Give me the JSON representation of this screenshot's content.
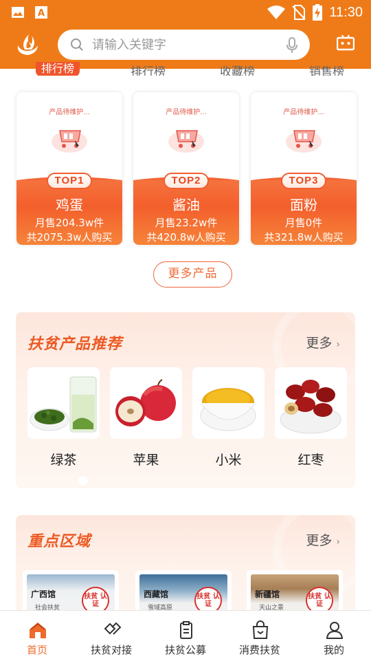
{
  "statusbar": {
    "time": "11:30"
  },
  "search": {
    "placeholder": "请输入关键字"
  },
  "tabs": [
    {
      "label": "排行榜",
      "active": true
    },
    {
      "label": "排行榜",
      "active": false
    },
    {
      "label": "收藏榜",
      "active": false
    },
    {
      "label": "销售榜",
      "active": false
    }
  ],
  "top_products": [
    {
      "placeholder": "产品待维护...",
      "rank": "TOP1",
      "name": "鸡蛋",
      "monthly": "月售204.3w件",
      "total": "共2075.3w人购买"
    },
    {
      "placeholder": "产品待维护...",
      "rank": "TOP2",
      "name": "酱油",
      "monthly": "月售23.2w件",
      "total": "共420.8w人购买"
    },
    {
      "placeholder": "产品待维护...",
      "rank": "TOP3",
      "name": "面粉",
      "monthly": "月售0件",
      "total": "共321.8w人购买"
    }
  ],
  "more_products_label": "更多产品",
  "poverty_section": {
    "title": "扶贫产品推荐",
    "more": "更多",
    "items": [
      {
        "name": "绿茶"
      },
      {
        "name": "苹果"
      },
      {
        "name": "小米"
      },
      {
        "name": "红枣"
      }
    ]
  },
  "region_section": {
    "title": "重点区域",
    "more": "更多",
    "items": [
      {
        "label": "广西馆",
        "sub": "社会扶贫",
        "stamp": "扶贫 认证"
      },
      {
        "label": "西藏馆",
        "sub": "雪域高原",
        "stamp": "扶贫 认证"
      },
      {
        "label": "新疆馆",
        "sub": "天山之景",
        "stamp": "扶贫 认证"
      }
    ]
  },
  "navbar": [
    {
      "label": "首页",
      "icon": "home-icon",
      "active": true
    },
    {
      "label": "扶贫对接",
      "icon": "handshake-icon",
      "active": false
    },
    {
      "label": "扶贫公募",
      "icon": "clipboard-icon",
      "active": false
    },
    {
      "label": "消费扶贫",
      "icon": "shopping-bag-icon",
      "active": false
    },
    {
      "label": "我的",
      "icon": "user-icon",
      "active": false
    }
  ],
  "colors": {
    "brand": "#ef7b18",
    "accent": "#f0542c"
  }
}
